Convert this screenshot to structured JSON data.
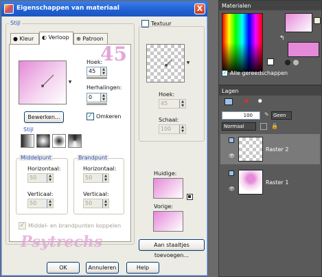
{
  "dialog": {
    "title": "Eigenschappen van materiaal",
    "close_label": "X",
    "style_group": "Stijl",
    "tabs": [
      {
        "label": "Kleur",
        "icon": "circle-icon"
      },
      {
        "label": "Verloop",
        "icon": "half-circle-icon"
      },
      {
        "label": "Patroon",
        "icon": "pattern-icon"
      }
    ],
    "angle_label": "Hoek:",
    "angle_value": "45",
    "repeats_label": "Herhalingen:",
    "repeats_value": "0",
    "edit_button": "Bewerken...",
    "invert_label": "Omkeren",
    "invert_checked": true,
    "style_label": "Stijl",
    "center_group": "Middelpunt",
    "focal_group": "Brandpunt",
    "center_h_label": "Horizontaal:",
    "center_h_value": "50",
    "center_v_label": "Verticaal:",
    "center_v_value": "50",
    "focal_h_label": "Horizontaal:",
    "focal_h_value": "50",
    "focal_v_label": "Verticaal:",
    "focal_v_value": "50",
    "link_label": "Middel- en brandpunten koppelen",
    "texture_label": "Textuur",
    "texture_angle_label": "Hoek:",
    "texture_angle_value": "45",
    "scale_label": "Schaal:",
    "scale_value": "100",
    "current_label": "Huidige:",
    "previous_label": "Vorige:",
    "add_swatch_button": "Aan staaltjes toevoegen...",
    "ok_button": "OK",
    "cancel_button": "Annuleren",
    "help_button": "Help",
    "watermark_number": "45",
    "watermark_name": "Psytrechs"
  },
  "materials": {
    "title": "Materialen",
    "all_tools_label": "Alle gereedschappen",
    "all_tools_checked": true
  },
  "layers": {
    "title": "Lagen",
    "opacity_value": "100",
    "blend_none_label": "Geen",
    "blend_mode": "Normaal",
    "items": [
      {
        "name": "Raster 2"
      },
      {
        "name": "Raster 1"
      }
    ]
  },
  "colors": {
    "accent": "#2a52be",
    "gradient_start": "#e58ad9",
    "gradient_end": "#ffffff",
    "watermark": "#e3a6d8"
  }
}
